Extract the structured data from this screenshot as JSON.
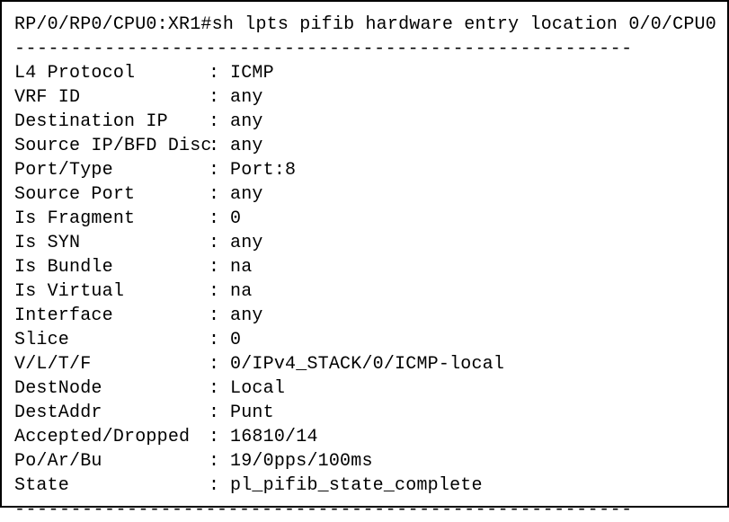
{
  "prompt": "RP/0/RP0/CPU0:XR1#",
  "command": "sh lpts pifib hardware entry location 0/0/CPU0",
  "divider": "-------------------------------------------------------",
  "sep": ": ",
  "rows": [
    {
      "label": "L4 Protocol       ",
      "value": "ICMP"
    },
    {
      "label": "VRF ID            ",
      "value": "any"
    },
    {
      "label": "Destination IP    ",
      "value": "any"
    },
    {
      "label": "Source IP/BFD Disc",
      "value": "any"
    },
    {
      "label": "Port/Type         ",
      "value": "Port:8"
    },
    {
      "label": "Source Port       ",
      "value": "any"
    },
    {
      "label": "Is Fragment       ",
      "value": "0"
    },
    {
      "label": "Is SYN            ",
      "value": "any"
    },
    {
      "label": "Is Bundle         ",
      "value": "na"
    },
    {
      "label": "Is Virtual        ",
      "value": "na"
    },
    {
      "label": "Interface         ",
      "value": "any"
    },
    {
      "label": "Slice             ",
      "value": "0"
    },
    {
      "label": "V/L/T/F           ",
      "value": "0/IPv4_STACK/0/ICMP-local"
    },
    {
      "label": "DestNode          ",
      "value": "Local"
    },
    {
      "label": "DestAddr          ",
      "value": "Punt"
    },
    {
      "label": "Accepted/Dropped  ",
      "value": "16810/14"
    },
    {
      "label": "Po/Ar/Bu          ",
      "value": "19/0pps/100ms"
    },
    {
      "label": "State             ",
      "value": "pl_pifib_state_complete"
    }
  ]
}
